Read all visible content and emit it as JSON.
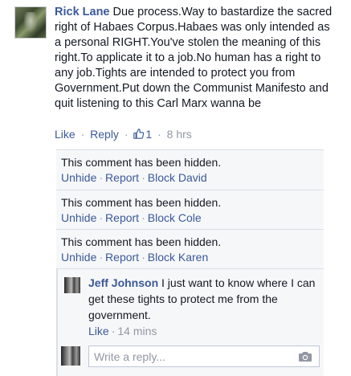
{
  "main_comment": {
    "author": "Rick Lane",
    "text": "Due process.Way to bastardize the sacred right of Habaes Corpus.Habaes was only intended as a personal RIGHT.You've stolen the meaning of this right.To applicate it to a job.No human has a right to any job.Tights are intended to protect you from Government.Put down the Communist Manifesto and quit listening to this Carl Marx wanna be",
    "like_label": "Like",
    "reply_label": "Reply",
    "like_count": "1",
    "time": "8 hrs"
  },
  "hidden_replies": [
    {
      "message": "This comment has been hidden.",
      "unhide_label": "Unhide",
      "report_label": "Report",
      "block_label": "Block David"
    },
    {
      "message": "This comment has been hidden.",
      "unhide_label": "Unhide",
      "report_label": "Report",
      "block_label": "Block Cole"
    },
    {
      "message": "This comment has been hidden.",
      "unhide_label": "Unhide",
      "report_label": "Report",
      "block_label": "Block Karen"
    }
  ],
  "nested_reply": {
    "author": "Jeff Johnson",
    "text": "I just want to know where I can get these tights to protect me from the government.",
    "like_label": "Like",
    "time": "14 mins"
  },
  "composer": {
    "placeholder": "Write a reply..."
  },
  "icons": {
    "like": "thumbs-up-icon",
    "camera": "camera-icon"
  },
  "colors": {
    "link": "#3b5998",
    "muted": "#9197a3",
    "reply_background": "#f6f7f9"
  }
}
